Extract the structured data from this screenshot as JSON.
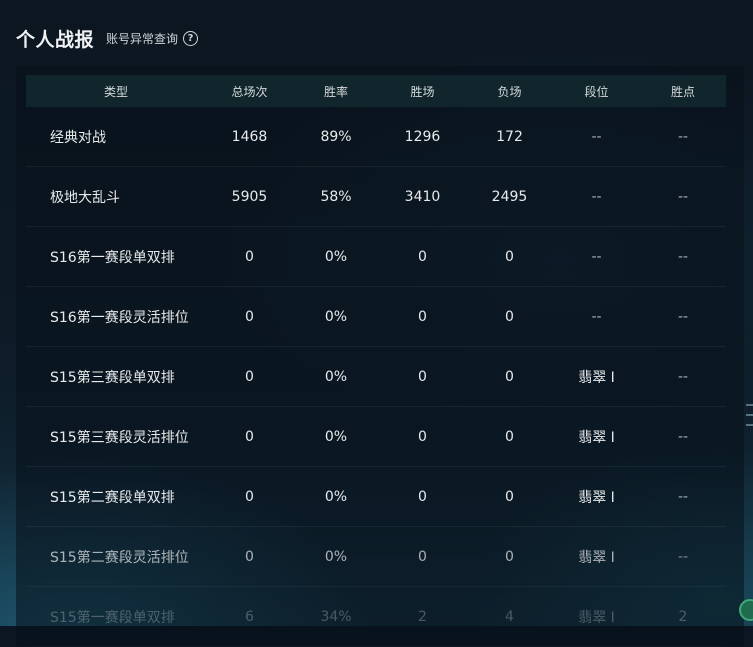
{
  "header": {
    "title": "个人战报",
    "anomaly_link": "账号异常查询",
    "help_glyph": "?"
  },
  "table": {
    "columns": [
      "类型",
      "总场次",
      "胜率",
      "胜场",
      "负场",
      "段位",
      "胜点"
    ],
    "rows": [
      [
        "经典对战",
        "1468",
        "89%",
        "1296",
        "172",
        "--",
        "--"
      ],
      [
        "极地大乱斗",
        "5905",
        "58%",
        "3410",
        "2495",
        "--",
        "--"
      ],
      [
        "S16第一赛段单双排",
        "0",
        "0%",
        "0",
        "0",
        "--",
        "--"
      ],
      [
        "S16第一赛段灵活排位",
        "0",
        "0%",
        "0",
        "0",
        "--",
        "--"
      ],
      [
        "S15第三赛段单双排",
        "0",
        "0%",
        "0",
        "0",
        "翡翠 I",
        "--"
      ],
      [
        "S15第三赛段灵活排位",
        "0",
        "0%",
        "0",
        "0",
        "翡翠 I",
        "--"
      ],
      [
        "S15第二赛段单双排",
        "0",
        "0%",
        "0",
        "0",
        "翡翠 I",
        "--"
      ],
      [
        "S15第二赛段灵活排位",
        "0",
        "0%",
        "0",
        "0",
        "翡翠 I",
        "--"
      ],
      [
        "S15第一赛段单双排",
        "6",
        "34%",
        "2",
        "4",
        "翡翠 I",
        "2"
      ]
    ]
  },
  "icons": {
    "help": "question-circle-icon",
    "corner": "app-badge-icon"
  },
  "colors": {
    "header_row_bg": "#10262c",
    "background": "#0b1622",
    "text": "#e8eaec"
  }
}
